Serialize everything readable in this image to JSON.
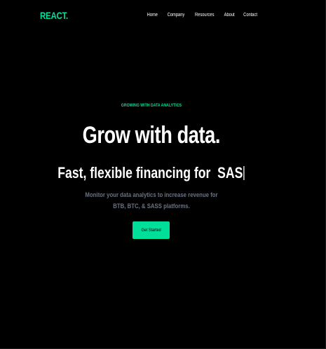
{
  "colors": {
    "background": "#000000",
    "accent": "#00df9a",
    "text": "#ffffff",
    "muted": "#6b7280"
  },
  "header": {
    "logo": "REACT.",
    "nav": [
      "Home",
      "Company",
      "Resources",
      "About",
      "Contact"
    ]
  },
  "hero": {
    "eyebrow": "GROWING WITH DATA ANALYTICS",
    "headline": "Grow with data.",
    "typed_prefix": "Fast, flexible financing for",
    "typed_word": "SAS",
    "description": "Monitor your data analytics to increase revenue for BTB, BTC, & SASS platforms.",
    "cta_label": "Get Started"
  }
}
